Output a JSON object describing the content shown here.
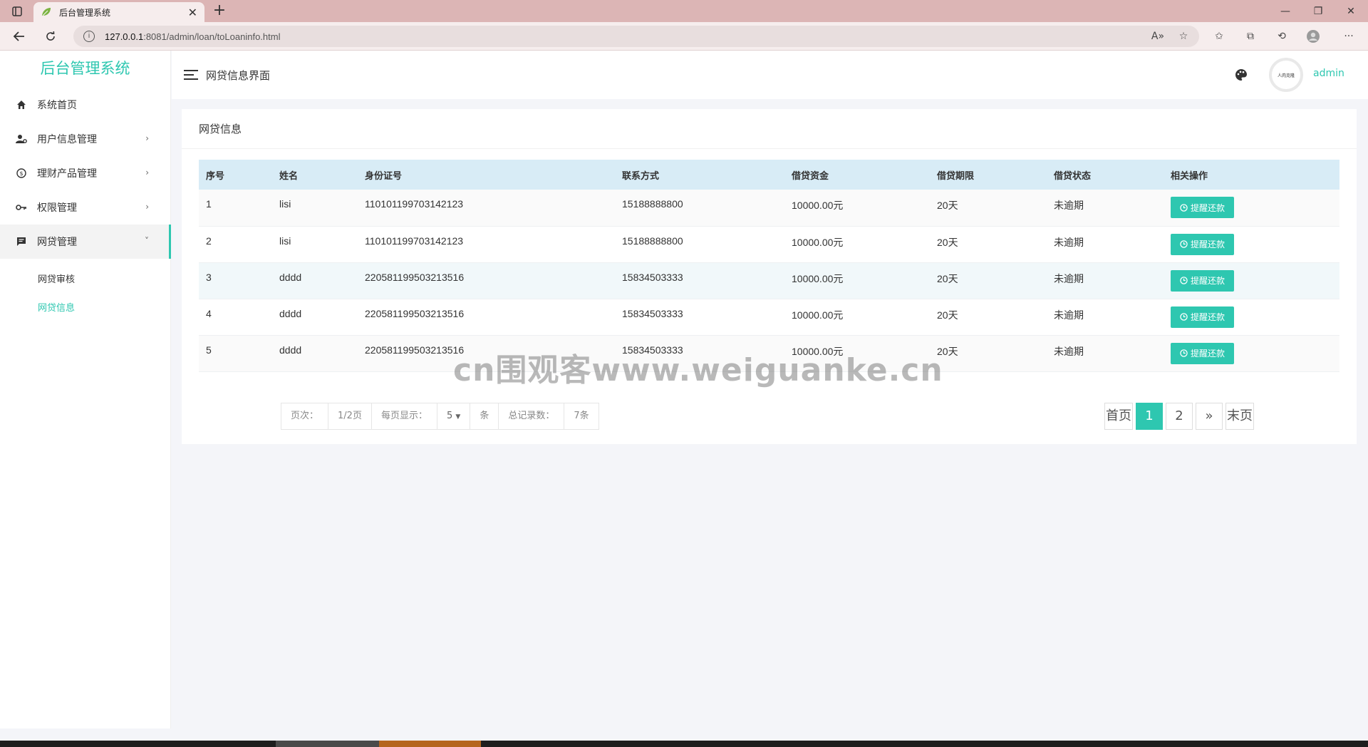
{
  "browser": {
    "tab_title": "后台管理系统",
    "url_host": "127.0.0.1",
    "url_path": ":8081/admin/loan/toLoaninfo.html",
    "accent": "#dcb5b5"
  },
  "sidebar": {
    "brand": "后台管理系统",
    "items": [
      {
        "label": "系统首页",
        "icon": "home-icon"
      },
      {
        "label": "用户信息管理",
        "icon": "user-gear-icon"
      },
      {
        "label": "理财产品管理",
        "icon": "coin-icon"
      },
      {
        "label": "权限管理",
        "icon": "key-icon"
      },
      {
        "label": "网贷管理",
        "icon": "message-icon"
      }
    ],
    "sub_items": [
      {
        "label": "网贷审核"
      },
      {
        "label": "网贷信息"
      }
    ]
  },
  "header": {
    "title": "网贷信息界面",
    "username": "admin",
    "avatar_text": "人肉克隆"
  },
  "card": {
    "title": "网贷信息",
    "columns": [
      "序号",
      "姓名",
      "身份证号",
      "联系方式",
      "借贷资金",
      "借贷期限",
      "借贷状态",
      "相关操作"
    ],
    "rows": [
      {
        "no": "1",
        "name": "lisi",
        "id": "110101199703142123",
        "phone": "15188888800",
        "amount": "10000.00元",
        "term": "20天",
        "status": "未逾期",
        "action": "提醒还款"
      },
      {
        "no": "2",
        "name": "lisi",
        "id": "110101199703142123",
        "phone": "15188888800",
        "amount": "10000.00元",
        "term": "20天",
        "status": "未逾期",
        "action": "提醒还款"
      },
      {
        "no": "3",
        "name": "dddd",
        "id": "220581199503213516",
        "phone": "15834503333",
        "amount": "10000.00元",
        "term": "20天",
        "status": "未逾期",
        "action": "提醒还款"
      },
      {
        "no": "4",
        "name": "dddd",
        "id": "220581199503213516",
        "phone": "15834503333",
        "amount": "10000.00元",
        "term": "20天",
        "status": "未逾期",
        "action": "提醒还款"
      },
      {
        "no": "5",
        "name": "dddd",
        "id": "220581199503213516",
        "phone": "15834503333",
        "amount": "10000.00元",
        "term": "20天",
        "status": "未逾期",
        "action": "提醒还款"
      }
    ]
  },
  "pagination": {
    "page_label": "页次：",
    "page_value": "1/2页",
    "per_page_label": "每页显示：",
    "per_page_value": "5",
    "unit": "条",
    "total_label": "总记录数：",
    "total_value": "7条",
    "first": "首页",
    "pages": [
      "1",
      "2"
    ],
    "next": "»",
    "last": "末页"
  },
  "watermark": "cn围观客www.weiguanke.cn",
  "colors": {
    "primary": "#2ec7b0",
    "table_header": "#d8ecf6"
  }
}
